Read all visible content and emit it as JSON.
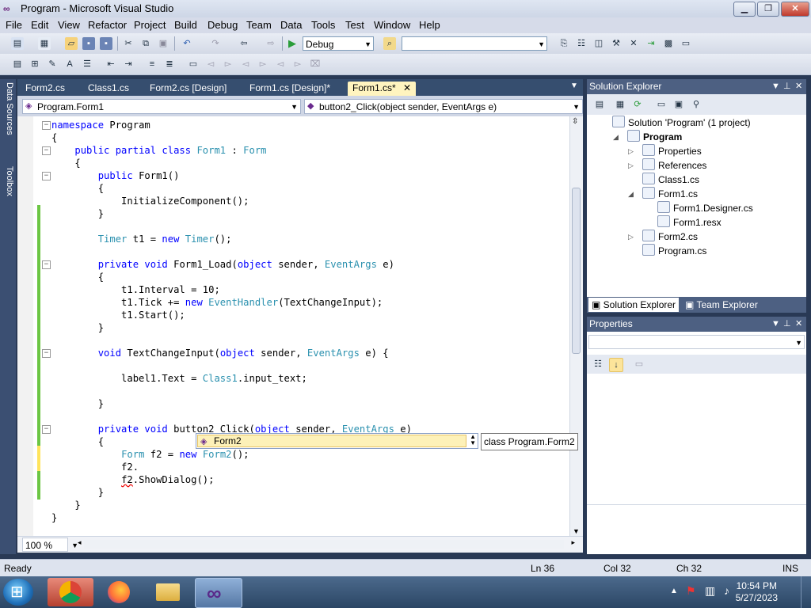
{
  "window": {
    "title": "Program - Microsoft Visual Studio",
    "buttons": {
      "minimize": "▁",
      "maximize": "❐",
      "close": "✕"
    }
  },
  "menu": [
    "File",
    "Edit",
    "View",
    "Refactor",
    "Project",
    "Build",
    "Debug",
    "Team",
    "Data",
    "Tools",
    "Test",
    "Window",
    "Help"
  ],
  "toolbar": {
    "config_value": "Debug",
    "platform_value": ""
  },
  "side_tabs": [
    "Data Sources",
    "Toolbox"
  ],
  "doc_tabs": [
    "Form2.cs",
    "Class1.cs",
    "Form2.cs [Design]",
    "Form1.cs [Design]*",
    "Form1.cs*"
  ],
  "nav": {
    "type_combo": "Program.Form1",
    "member_combo": "button2_Click(object sender, EventArgs e)"
  },
  "code": [
    [
      {
        "t": "namespace",
        "c": "kw"
      },
      {
        "t": " Program"
      }
    ],
    [
      {
        "t": "{"
      }
    ],
    [
      {
        "t": "    "
      },
      {
        "t": "public partial class",
        "c": "kw"
      },
      {
        "t": " "
      },
      {
        "t": "Form1",
        "c": "ty"
      },
      {
        "t": " : "
      },
      {
        "t": "Form",
        "c": "ty"
      }
    ],
    [
      {
        "t": "    {"
      }
    ],
    [
      {
        "t": "        "
      },
      {
        "t": "public",
        "c": "kw"
      },
      {
        "t": " Form1()"
      }
    ],
    [
      {
        "t": "        {"
      }
    ],
    [
      {
        "t": "            InitializeComponent();"
      }
    ],
    [
      {
        "t": "        }"
      }
    ],
    [
      {
        "t": ""
      }
    ],
    [
      {
        "t": "        "
      },
      {
        "t": "Timer",
        "c": "ty"
      },
      {
        "t": " t1 = "
      },
      {
        "t": "new",
        "c": "kw"
      },
      {
        "t": " "
      },
      {
        "t": "Timer",
        "c": "ty"
      },
      {
        "t": "();"
      }
    ],
    [
      {
        "t": ""
      }
    ],
    [
      {
        "t": "        "
      },
      {
        "t": "private void",
        "c": "kw"
      },
      {
        "t": " Form1_Load("
      },
      {
        "t": "object",
        "c": "kw"
      },
      {
        "t": " sender, "
      },
      {
        "t": "EventArgs",
        "c": "ty"
      },
      {
        "t": " e)"
      }
    ],
    [
      {
        "t": "        {"
      }
    ],
    [
      {
        "t": "            t1.Interval = 10;"
      }
    ],
    [
      {
        "t": "            t1.Tick += "
      },
      {
        "t": "new",
        "c": "kw"
      },
      {
        "t": " "
      },
      {
        "t": "EventHandler",
        "c": "ty"
      },
      {
        "t": "(TextChangeInput);"
      }
    ],
    [
      {
        "t": "            t1.Start();"
      }
    ],
    [
      {
        "t": "        }"
      }
    ],
    [
      {
        "t": ""
      }
    ],
    [
      {
        "t": "        "
      },
      {
        "t": "void",
        "c": "kw"
      },
      {
        "t": " TextChangeInput("
      },
      {
        "t": "object",
        "c": "kw"
      },
      {
        "t": " sender, "
      },
      {
        "t": "EventArgs",
        "c": "ty"
      },
      {
        "t": " e) {"
      }
    ],
    [
      {
        "t": ""
      }
    ],
    [
      {
        "t": "            label1.Text = "
      },
      {
        "t": "Class1",
        "c": "ty"
      },
      {
        "t": ".input_text;"
      }
    ],
    [
      {
        "t": ""
      }
    ],
    [
      {
        "t": "        }"
      }
    ],
    [
      {
        "t": ""
      }
    ],
    [
      {
        "t": "        "
      },
      {
        "t": "private void",
        "c": "kw"
      },
      {
        "t": " button2_Click("
      },
      {
        "t": "object",
        "c": "kw"
      },
      {
        "t": " sender, "
      },
      {
        "t": "EventArgs",
        "c": "ty"
      },
      {
        "t": " e)"
      }
    ],
    [
      {
        "t": "        {"
      }
    ],
    [
      {
        "t": "            "
      },
      {
        "t": "Form",
        "c": "ty"
      },
      {
        "t": " f2 = "
      },
      {
        "t": "new",
        "c": "kw"
      },
      {
        "t": " "
      },
      {
        "t": "Form2",
        "c": "ty"
      },
      {
        "t": "();"
      }
    ],
    [
      {
        "t": "            f2."
      }
    ],
    [
      {
        "t": "            "
      },
      {
        "t": "f2",
        "c": "sq"
      },
      {
        "t": ".ShowDialog();"
      }
    ],
    [
      {
        "t": "        }"
      }
    ],
    [
      {
        "t": "    }"
      }
    ],
    [
      {
        "t": "}"
      }
    ]
  ],
  "intellisense": {
    "item": "Form2",
    "tooltip": "class Program.Form2"
  },
  "zoom": "100 %",
  "solution_explorer": {
    "title": "Solution Explorer",
    "items": [
      {
        "label": "Solution 'Program' (1 project)",
        "level": 0,
        "expander": "",
        "bold": false
      },
      {
        "label": "Program",
        "level": 1,
        "expander": "◢",
        "bold": true
      },
      {
        "label": "Properties",
        "level": 2,
        "expander": "▷",
        "bold": false
      },
      {
        "label": "References",
        "level": 2,
        "expander": "▷",
        "bold": false
      },
      {
        "label": "Class1.cs",
        "level": 2,
        "expander": "",
        "bold": false
      },
      {
        "label": "Form1.cs",
        "level": 2,
        "expander": "◢",
        "bold": false
      },
      {
        "label": "Form1.Designer.cs",
        "level": 3,
        "expander": "",
        "bold": false
      },
      {
        "label": "Form1.resx",
        "level": 3,
        "expander": "",
        "bold": false
      },
      {
        "label": "Form2.cs",
        "level": 2,
        "expander": "▷",
        "bold": false
      },
      {
        "label": "Program.cs",
        "level": 2,
        "expander": "",
        "bold": false
      }
    ],
    "tabs": [
      "Solution Explorer",
      "Team Explorer"
    ]
  },
  "properties": {
    "title": "Properties"
  },
  "status": {
    "ready": "Ready",
    "ln": "Ln 36",
    "col": "Col 32",
    "ch": "Ch 32",
    "mode": "INS"
  },
  "clock": {
    "time": "10:54 PM",
    "date": "5/27/2023"
  }
}
